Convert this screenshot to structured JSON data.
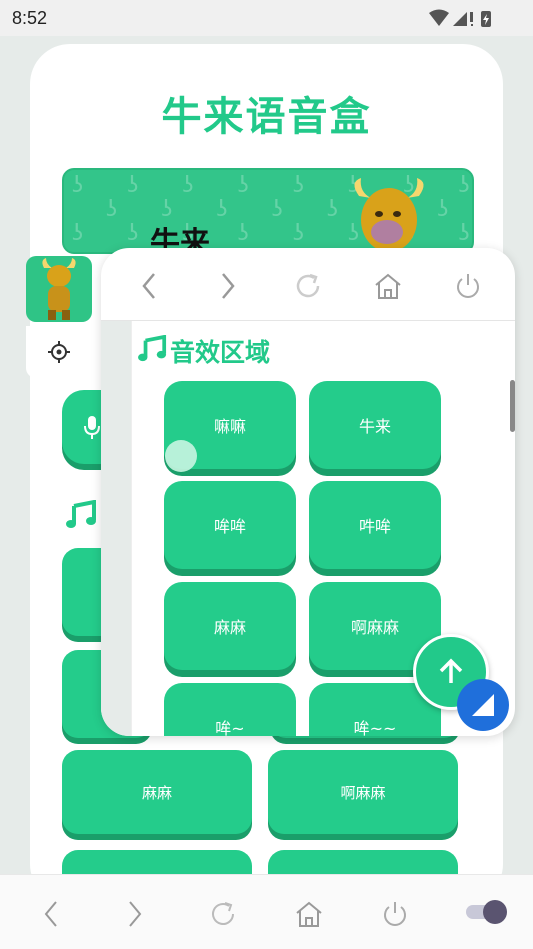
{
  "status_bar": {
    "time": "8:52"
  },
  "app": {
    "title": "牛来语音盒"
  },
  "banner": {
    "text": "牛来"
  },
  "background_buttons": [
    {
      "label": "麻麻"
    },
    {
      "label": "啊麻麻"
    }
  ],
  "floating_window": {
    "section_title": "音效区域",
    "buttons": [
      {
        "label": "嘛嘛"
      },
      {
        "label": "牛来"
      },
      {
        "label": "哞哞"
      },
      {
        "label": "吽哞"
      },
      {
        "label": "麻麻"
      },
      {
        "label": "啊麻麻"
      },
      {
        "label": "哞~"
      },
      {
        "label": "哞~~"
      }
    ]
  },
  "icons": {
    "nav_back": "chevron-left-icon",
    "nav_forward": "chevron-right-icon",
    "refresh": "refresh-icon",
    "home": "home-icon",
    "power": "power-icon",
    "gear": "gear-icon",
    "music": "music-note-icon",
    "mic": "mic-icon",
    "scroll_top": "arrow-up-icon",
    "resize": "resize-triangle-icon"
  },
  "colors": {
    "accent": "#22c98a",
    "button": "#24cc8b",
    "button_shadow": "#1a9e6a",
    "fab_blue": "#1f6fdb"
  }
}
